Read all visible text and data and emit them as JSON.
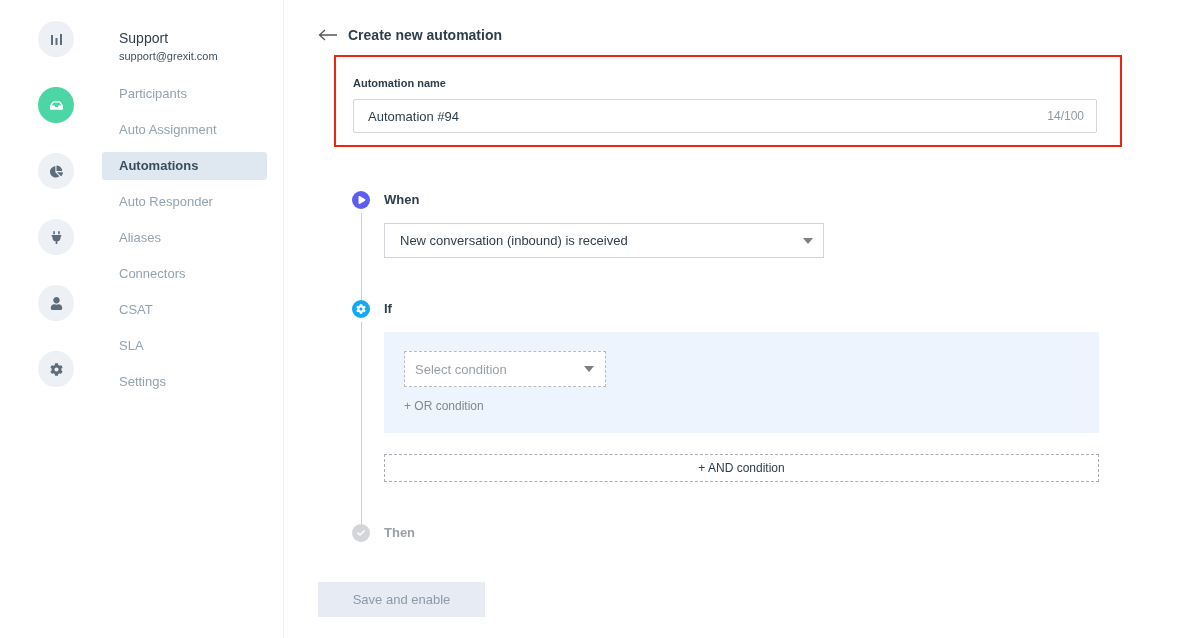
{
  "rail": [
    {
      "kind": "bars",
      "selected": false
    },
    {
      "kind": "inbox",
      "selected": true
    },
    {
      "kind": "pie",
      "selected": false
    },
    {
      "kind": "plug",
      "selected": false
    },
    {
      "kind": "user",
      "selected": false
    },
    {
      "kind": "gear",
      "selected": false
    }
  ],
  "account": {
    "name": "Support",
    "email": "support@grexit.com"
  },
  "nav": [
    {
      "label": "Participants",
      "selected": false
    },
    {
      "label": "Auto Assignment",
      "selected": false
    },
    {
      "label": "Automations",
      "selected": true
    },
    {
      "label": "Auto Responder",
      "selected": false
    },
    {
      "label": "Aliases",
      "selected": false
    },
    {
      "label": "Connectors",
      "selected": false
    },
    {
      "label": "CSAT",
      "selected": false
    },
    {
      "label": "SLA",
      "selected": false
    },
    {
      "label": "Settings",
      "selected": false
    }
  ],
  "page_title": "Create new automation",
  "name_field": {
    "label": "Automation name",
    "value": "Automation #94",
    "counter": "14/100",
    "highlighted": true
  },
  "steps": [
    {
      "kind": "when",
      "title": "When",
      "active": true,
      "trigger": "New conversation (inbound) is received"
    },
    {
      "kind": "if",
      "title": "If",
      "active": true,
      "condition_placeholder": "Select condition",
      "or_label": "+ OR condition",
      "and_label": "+ AND condition"
    },
    {
      "kind": "then",
      "title": "Then",
      "active": false
    }
  ],
  "save_button": {
    "label": "Save and enable",
    "disabled": true
  }
}
